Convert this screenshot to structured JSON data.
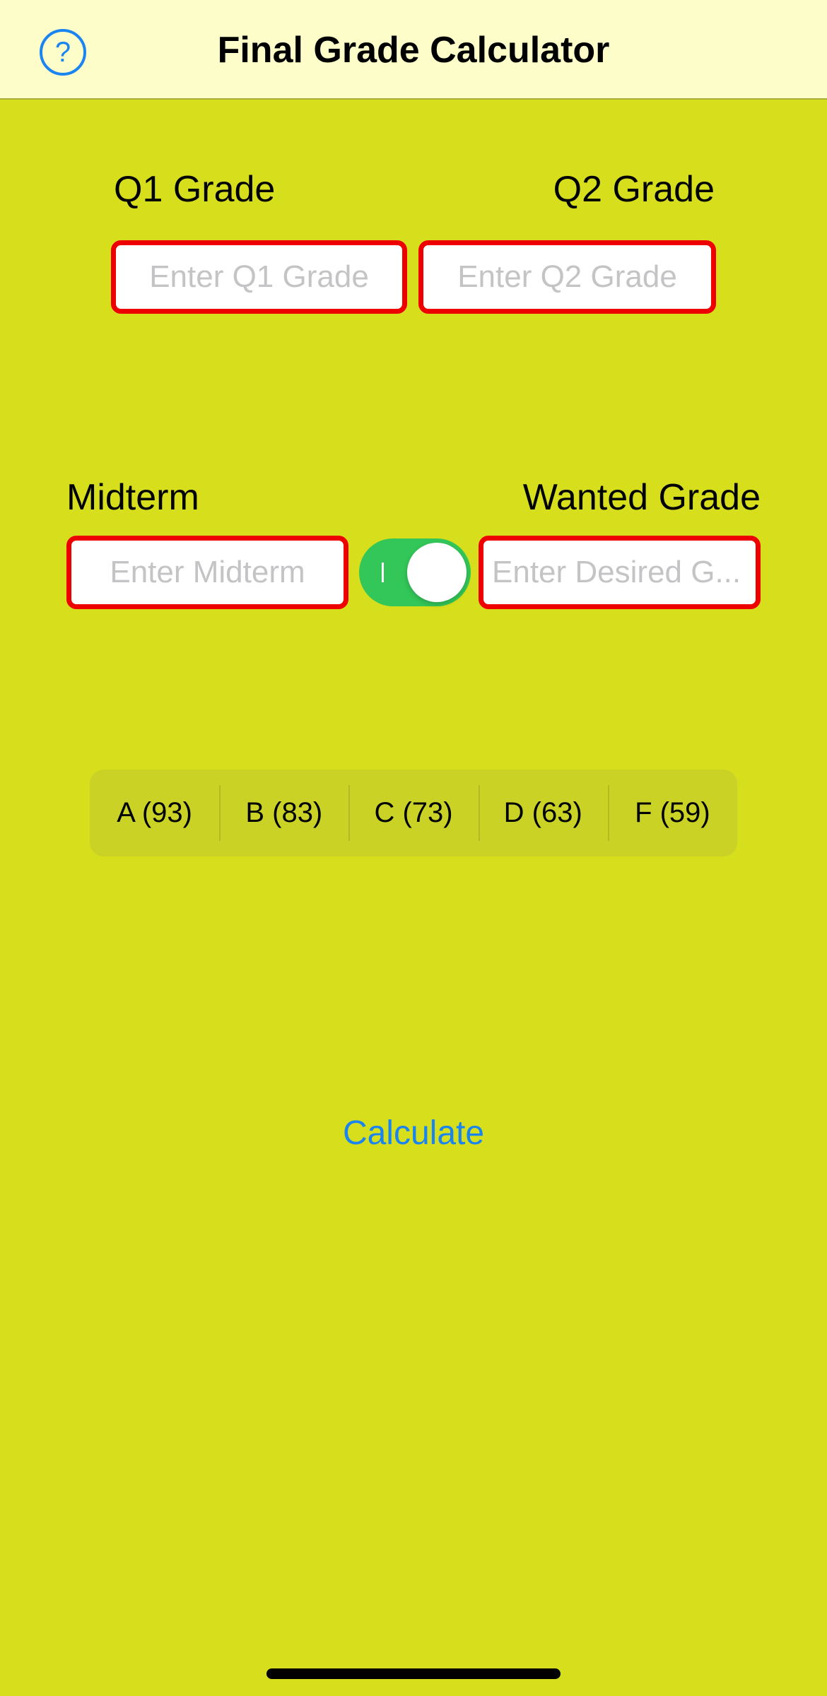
{
  "header": {
    "title": "Final Grade Calculator",
    "help_icon": "?"
  },
  "fields": {
    "q1": {
      "label": "Q1 Grade",
      "placeholder": "Enter Q1 Grade",
      "value": ""
    },
    "q2": {
      "label": "Q2 Grade",
      "placeholder": "Enter Q2 Grade",
      "value": ""
    },
    "midterm": {
      "label": "Midterm",
      "placeholder": "Enter Midterm",
      "value": ""
    },
    "wanted": {
      "label": "Wanted Grade",
      "placeholder": "Enter Desired G...",
      "value": ""
    }
  },
  "toggle": {
    "state": "on"
  },
  "grade_options": [
    "A (93)",
    "B (83)",
    "C (73)",
    "D (63)",
    "F (59)"
  ],
  "actions": {
    "calculate_label": "Calculate"
  },
  "colors": {
    "background": "#d7df1c",
    "nav_background": "#fdfdc9",
    "accent": "#1a84f0",
    "field_border": "#ee0000",
    "toggle_on": "#33c759"
  }
}
